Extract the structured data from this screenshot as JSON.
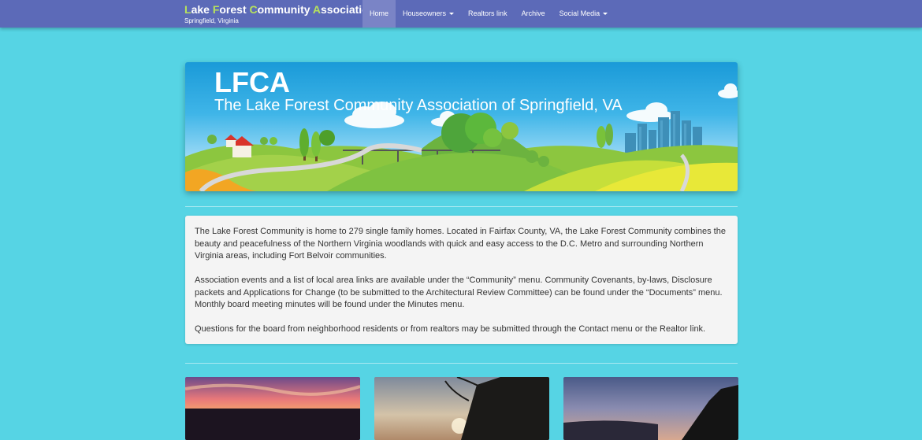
{
  "navbar": {
    "brand": {
      "parts": [
        {
          "text": "L",
          "accent": true
        },
        {
          "text": "ake ",
          "accent": false
        },
        {
          "text": "F",
          "accent": true
        },
        {
          "text": "orest ",
          "accent": false
        },
        {
          "text": "C",
          "accent": true
        },
        {
          "text": "ommunity ",
          "accent": false
        },
        {
          "text": "A",
          "accent": true
        },
        {
          "text": "ssociation",
          "accent": false
        }
      ],
      "subtitle": "Springfield, Virginia"
    },
    "items": [
      {
        "label": "Home",
        "active": true,
        "dropdown": false
      },
      {
        "label": "Houseowners",
        "active": false,
        "dropdown": true
      },
      {
        "label": "Realtors link",
        "active": false,
        "dropdown": false
      },
      {
        "label": "Archive",
        "active": false,
        "dropdown": false
      },
      {
        "label": "Social Media",
        "active": false,
        "dropdown": true
      }
    ]
  },
  "banner": {
    "title": "LFCA",
    "subtitle": "The Lake Forest Community Association of Springfield, VA"
  },
  "intro": {
    "paragraphs": [
      "The Lake Forest Community is home to 279 single family homes. Located in Fairfax County, VA, the Lake Forest Community combines the beauty and peacefulness of the Northern Virginia woodlands with quick and easy access to the D.C. Metro and surrounding Northern Virginia areas, including Fort Belvoir communities.",
      "Association events and a list of local area links are available under the “Community” menu. Community Covenants, by-laws, Disclosure packets and Applications for Change (to be submitted to the Architectural Review Committee) can be found under the “Documents” menu. Monthly board meeting minutes will be found under the Minutes menu.",
      "Questions for the board from neighborhood residents or from realtors may be submitted through the Contact menu or the Realtor link."
    ]
  },
  "colors": {
    "page_background": "#56d4e4",
    "navbar": "#5c6ab8",
    "nav_active": "#7a84c6",
    "brand_accent": "#b7e35c",
    "panel": "#f4f4f4"
  }
}
